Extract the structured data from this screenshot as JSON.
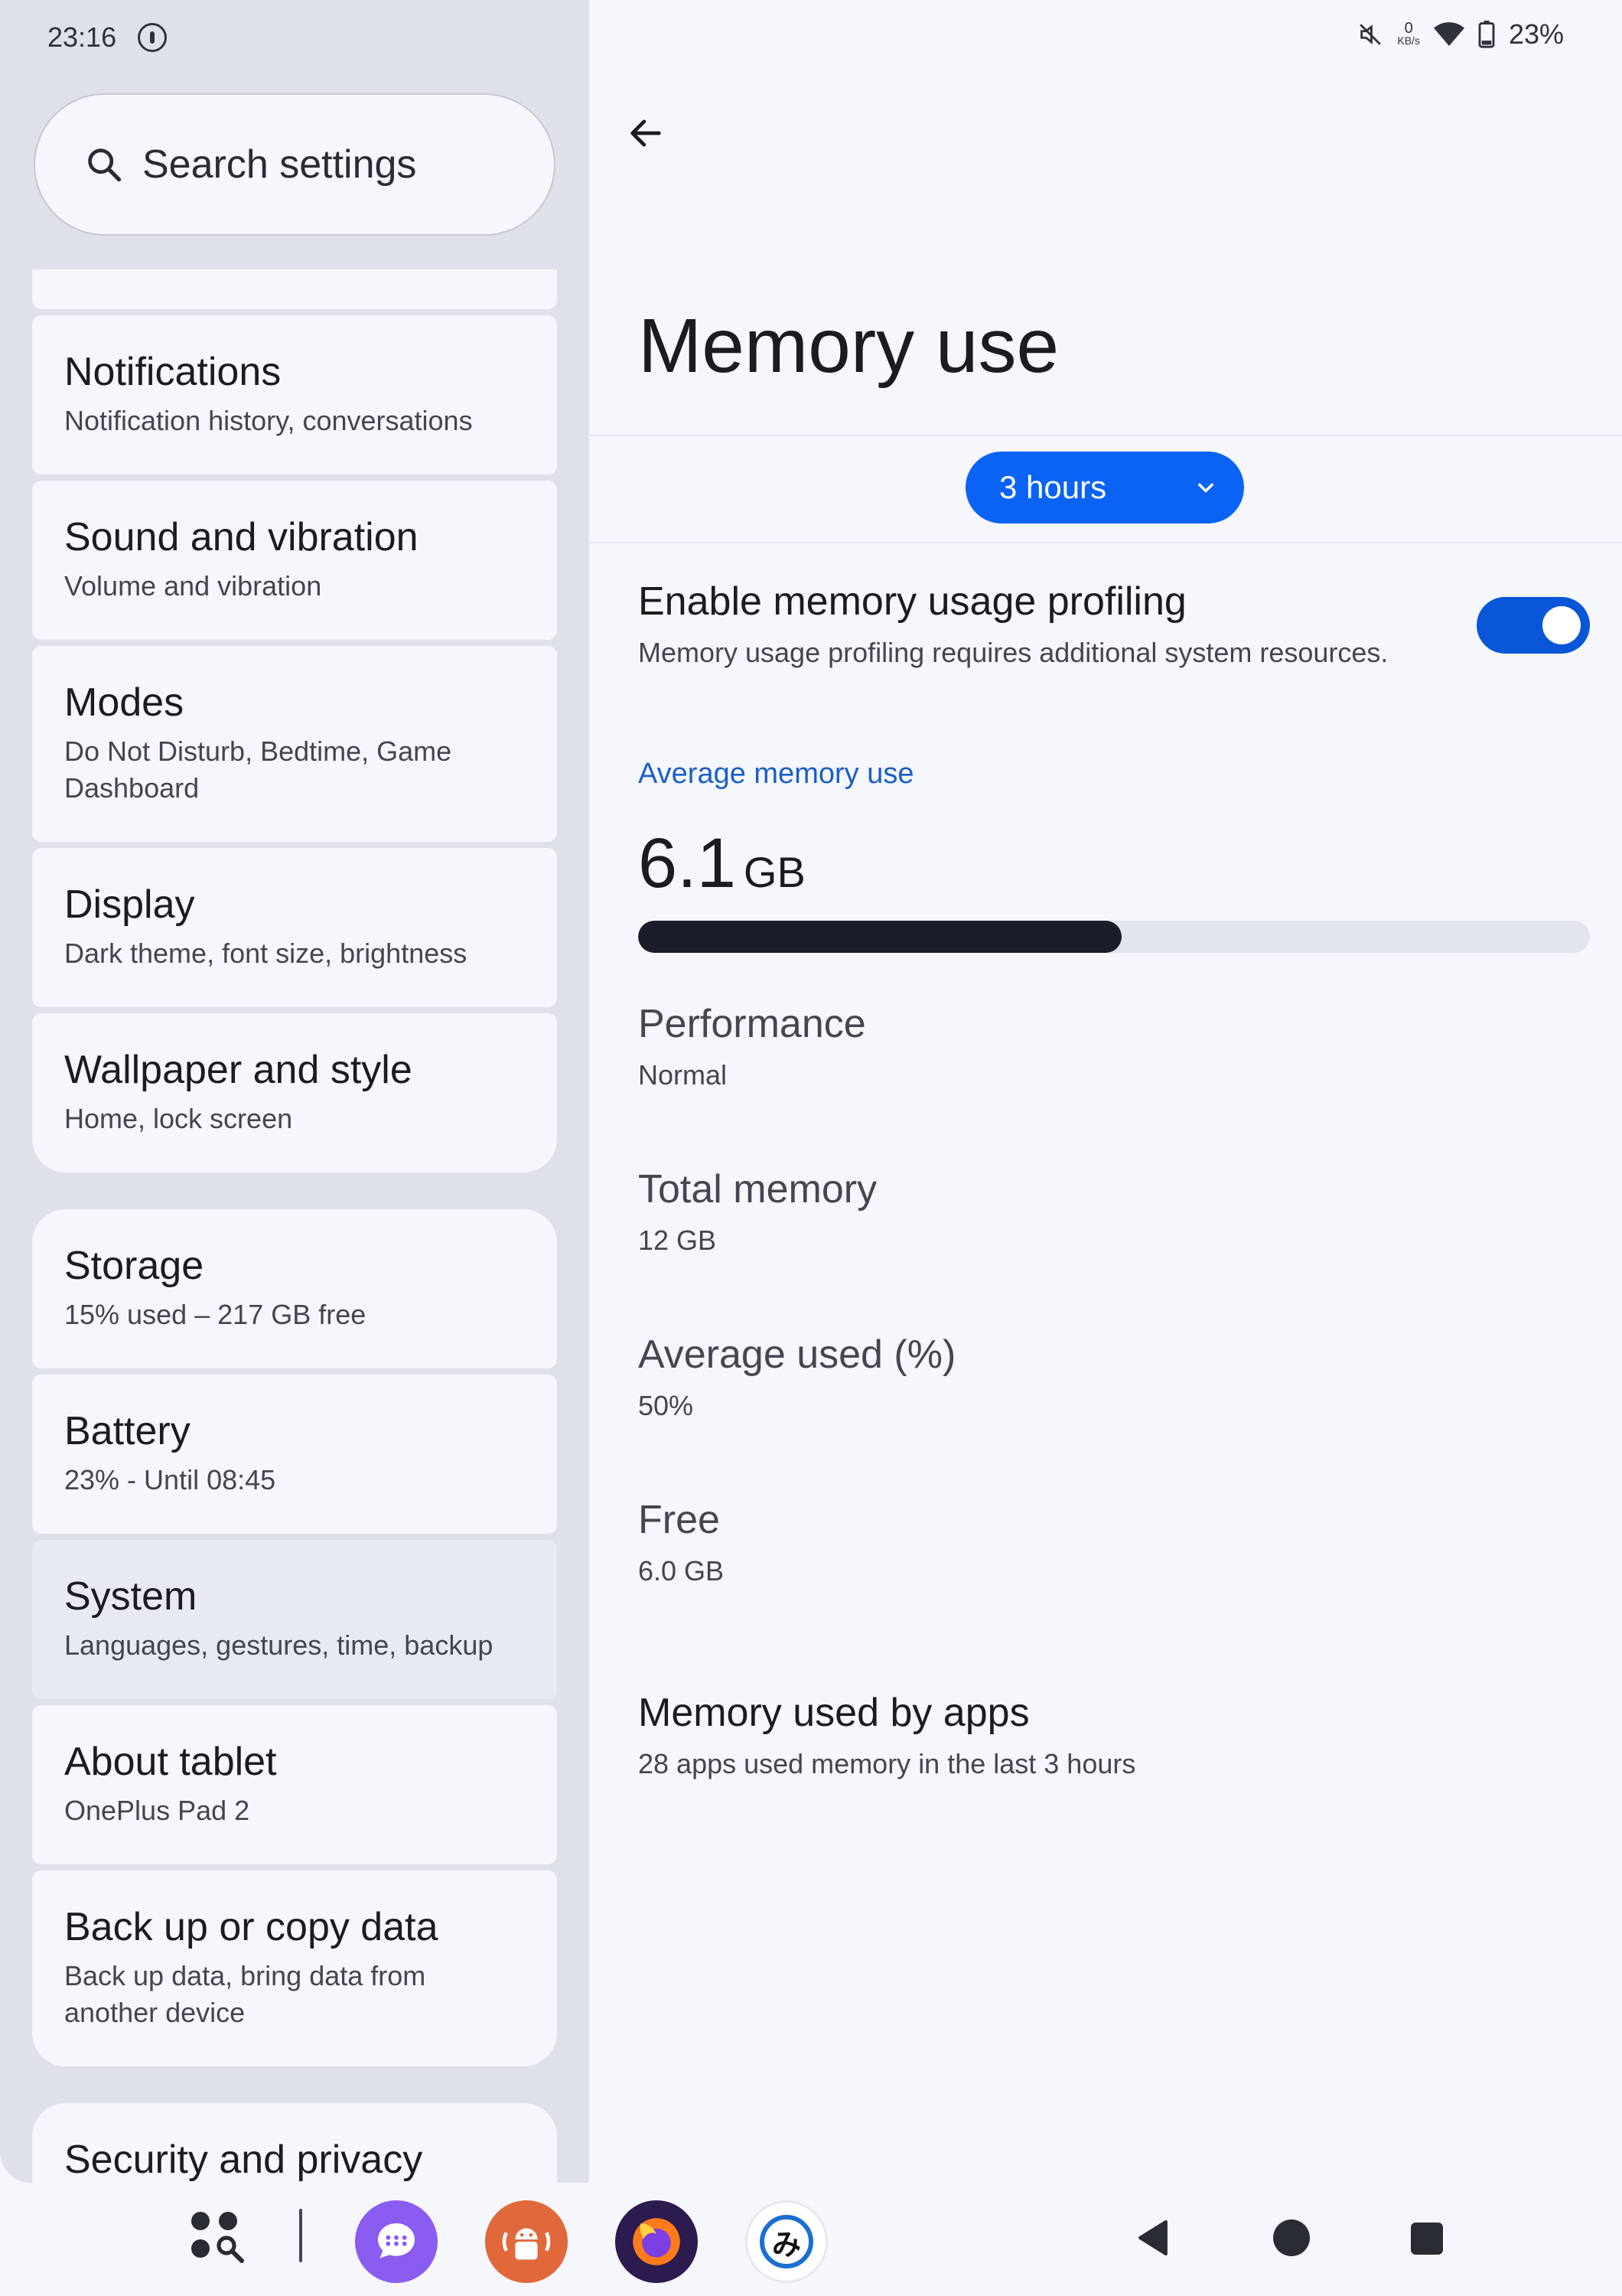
{
  "status_bar": {
    "time": "23:16",
    "net_speed_value": "0",
    "net_speed_unit": "KB/s",
    "battery": "23%"
  },
  "search": {
    "placeholder": "Search settings"
  },
  "settings_list": [
    {
      "title": "Notifications",
      "subtitle": "Notification history, conversations"
    },
    {
      "title": "Sound and vibration",
      "subtitle": "Volume and vibration"
    },
    {
      "title": "Modes",
      "subtitle": "Do Not Disturb, Bedtime, Game Dashboard"
    },
    {
      "title": "Display",
      "subtitle": "Dark theme, font size, brightness"
    },
    {
      "title": "Wallpaper and style",
      "subtitle": "Home, lock screen"
    },
    {
      "title": "Storage",
      "subtitle": "15% used – 217 GB free"
    },
    {
      "title": "Battery",
      "subtitle": "23% - Until 08:45"
    },
    {
      "title": "System",
      "subtitle": "Languages, gestures, time, backup",
      "selected": true
    },
    {
      "title": "About tablet",
      "subtitle": "OnePlus Pad 2"
    },
    {
      "title": "Back up or copy data",
      "subtitle": "Back up data, bring data from another device"
    },
    {
      "title": "Security and privacy",
      "subtitle": ""
    }
  ],
  "page": {
    "title": "Memory use",
    "time_range": "3 hours",
    "profiling": {
      "title": "Enable memory usage profiling",
      "subtitle": "Memory usage profiling requires additional system resources.",
      "enabled": true
    },
    "average_header": "Average memory use",
    "average_value": "6.1",
    "average_unit": "GB",
    "average_fraction": 0.508,
    "stats": [
      {
        "title": "Performance",
        "value": "Normal"
      },
      {
        "title": "Total memory",
        "value": "12 GB"
      },
      {
        "title": "Average used (%)",
        "value": "50%"
      },
      {
        "title": "Free",
        "value": "6.0 GB"
      }
    ],
    "apps": {
      "title": "Memory used by apps",
      "subtitle": "28 apps used memory in the last 3 hours"
    }
  },
  "taskbar": {
    "apps": [
      "app-drawer-icon",
      "messages-app-icon",
      "android-debug-app-icon",
      "firefox-app-icon",
      "mi-app-icon"
    ]
  },
  "colors": {
    "accent": "#0a63f5",
    "toggle_on": "#0a56d8",
    "left_pane_bg": "#dfe1ea",
    "card_bg": "#f6f7fc",
    "selected_card_bg": "#e8eaf3",
    "section_header": "#1a5fc8"
  }
}
